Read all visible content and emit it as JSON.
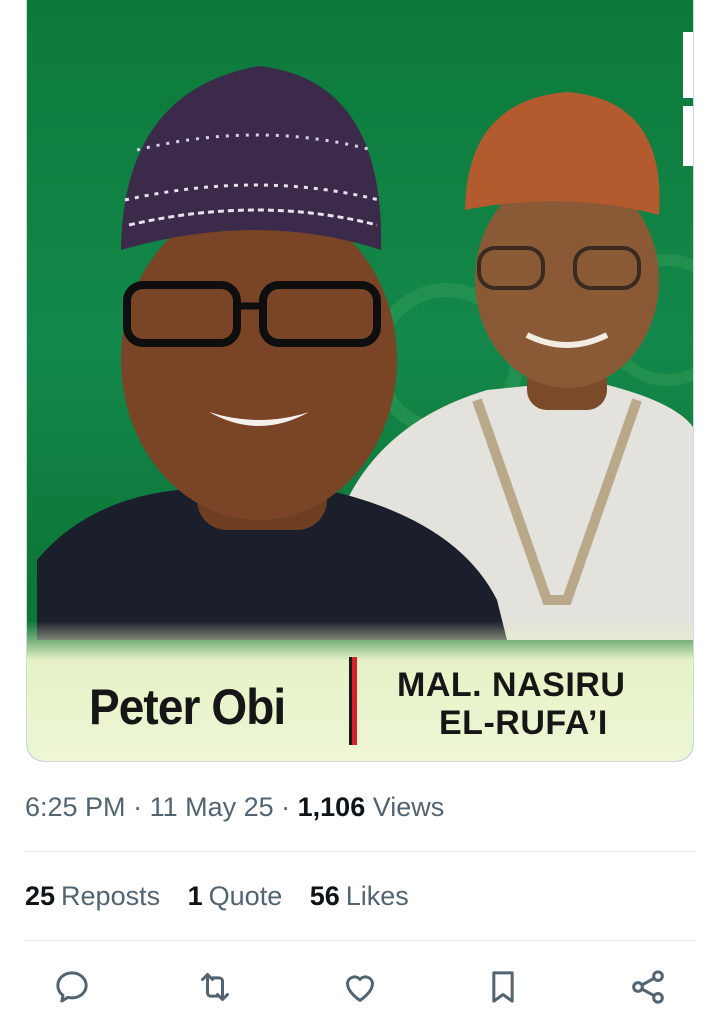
{
  "post": {
    "image": {
      "left_name": "Peter Obi",
      "right_name_line1": "MAL.  NASIRU",
      "right_name_line2": "EL-RUFA’I",
      "background_color": "#0e7a3c",
      "accent_red": "#d3222a"
    },
    "meta": {
      "time": "6:25 PM",
      "separator": " · ",
      "date": "11 May 25",
      "views_count": "1,106",
      "views_label": "Views"
    },
    "stats": {
      "reposts_count": "25",
      "reposts_label": "Reposts",
      "quotes_count": "1",
      "quotes_label": "Quote",
      "likes_count": "56",
      "likes_label": "Likes"
    },
    "actions": [
      "reply-icon",
      "repost-icon",
      "like-icon",
      "bookmark-icon",
      "share-icon"
    ]
  }
}
